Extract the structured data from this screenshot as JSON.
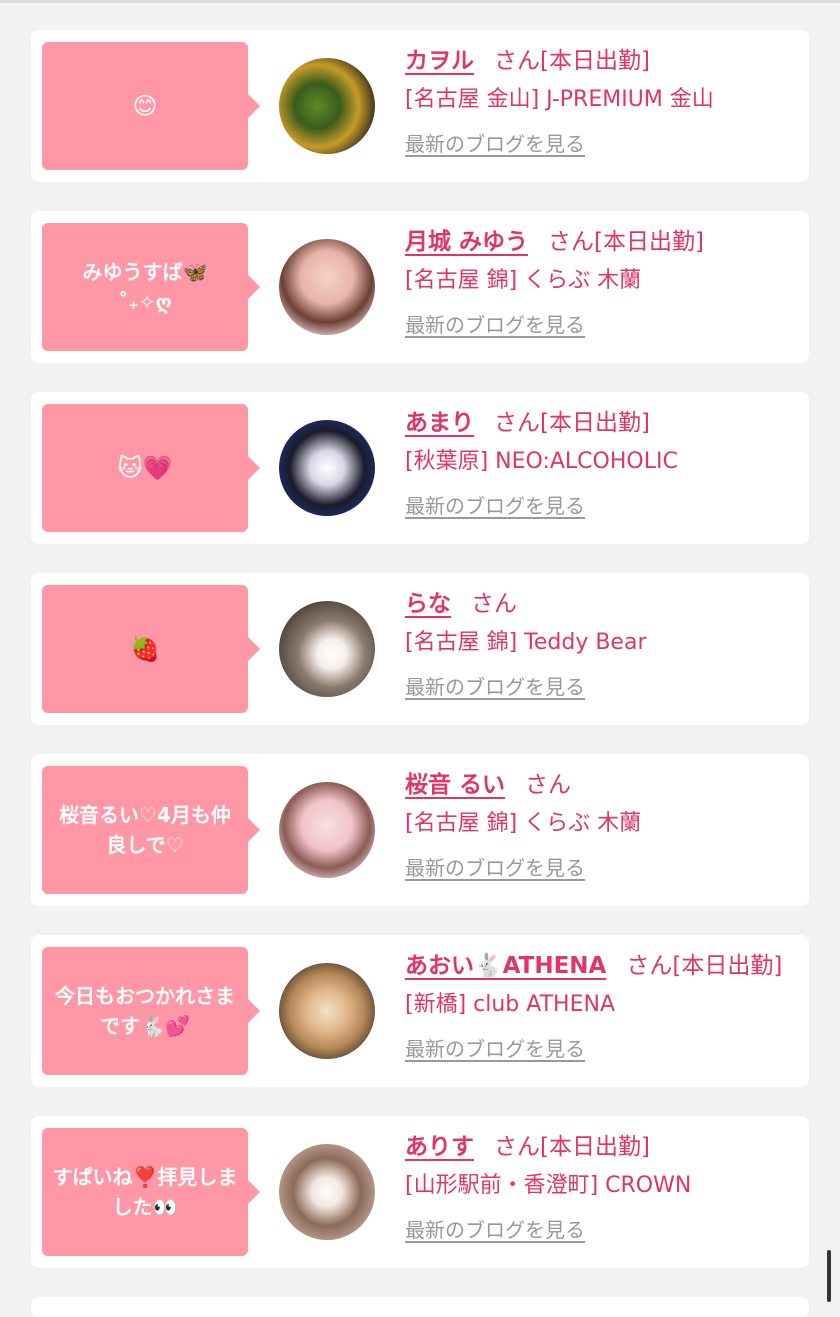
{
  "items": [
    {
      "message": "😊",
      "name": "カヲル",
      "suffix": "さん[本日出勤]",
      "shop": "[名古屋 金山] J-PREMIUM 金山",
      "blog_link": "最新のブログを見る",
      "avatar": "avatar-photo"
    },
    {
      "message": "みゆうすば🦋\n˚₊✧ღ",
      "name": "月城 みゆう",
      "suffix": "さん[本日出勤]",
      "shop": "[名古屋 錦] くらぶ 木蘭",
      "blog_link": "最新のブログを見る",
      "avatar": "avatar-photo"
    },
    {
      "message": "🐱💗",
      "name": "あまり",
      "suffix": "さん[本日出勤]",
      "shop": "[秋葉原] NEO:ALCOHOLIC",
      "blog_link": "最新のブログを見る",
      "avatar": "avatar-photo"
    },
    {
      "message": "🍓",
      "name": "らな",
      "suffix": "さん",
      "shop": "[名古屋 錦] Teddy Bear",
      "blog_link": "最新のブログを見る",
      "avatar": "avatar-photo"
    },
    {
      "message": "桜音るい♡4月も仲良しで♡",
      "name": "桜音 るい",
      "suffix": "さん",
      "shop": "[名古屋 錦] くらぶ 木蘭",
      "blog_link": "最新のブログを見る",
      "avatar": "avatar-photo"
    },
    {
      "message": "今日もおつかれさまです🐇💕",
      "name": "あおい🐇ATHENA",
      "suffix": "さん[本日出勤]",
      "shop": "[新橋] club ATHENA",
      "blog_link": "最新のブログを見る",
      "avatar": "avatar-photo"
    },
    {
      "message": "すぱいね❣️拝見しました👀",
      "name": "ありす",
      "suffix": "さん[本日出勤]",
      "shop": "[山形駅前・香澄町] CROWN",
      "blog_link": "最新のブログを見る",
      "avatar": "avatar-photo"
    }
  ],
  "colors": {
    "accent": "#e0346a",
    "bubble": "#ff97a6",
    "link_gray": "#999999",
    "background": "#f2f2f2",
    "card": "#ffffff"
  }
}
